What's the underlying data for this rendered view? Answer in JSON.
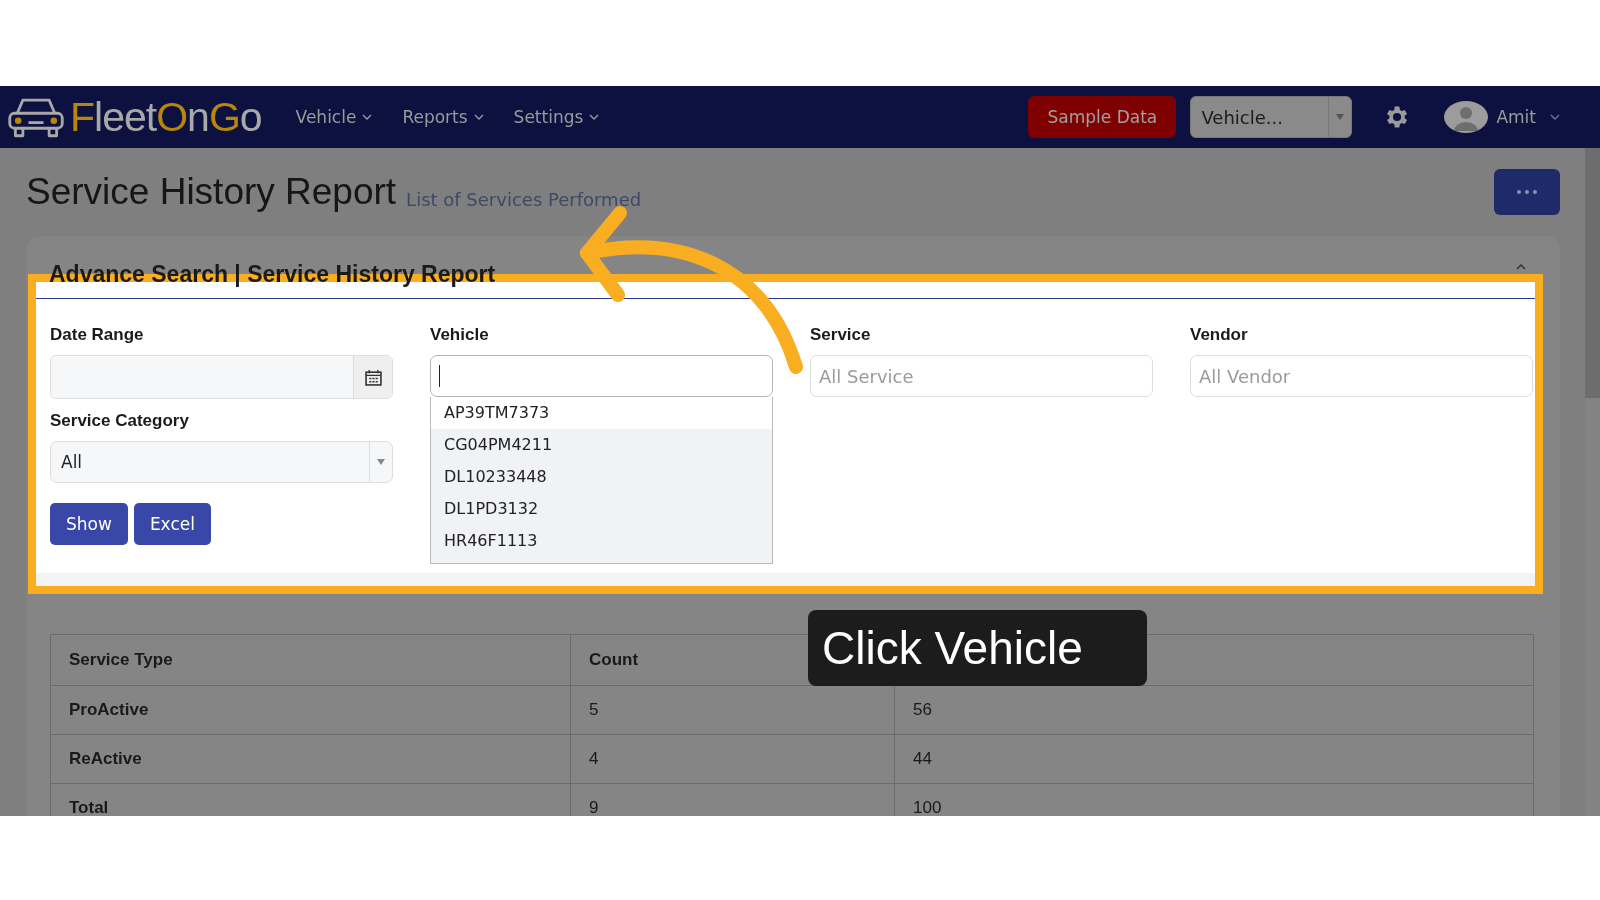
{
  "logo": {
    "parts": [
      {
        "text": "F",
        "accent": true
      },
      {
        "text": "leet",
        "accent": false
      },
      {
        "text": "O",
        "accent": true
      },
      {
        "text": "n",
        "accent": false
      },
      {
        "text": "G",
        "accent": true
      },
      {
        "text": "o",
        "accent": false
      }
    ]
  },
  "nav": {
    "menus": [
      "Vehicle",
      "Reports",
      "Settings"
    ],
    "sample_data_button": "Sample Data",
    "vehicle_select": "Vehicle...",
    "user": "Amit"
  },
  "page": {
    "title": "Service History Report",
    "subtitle": "List of Services Performed"
  },
  "search": {
    "title": "Advance Search | Service History Report",
    "expanded": true,
    "fields": [
      {
        "kind": "date",
        "label": "Date Range"
      },
      {
        "kind": "search",
        "label": "Vehicle",
        "focused": true,
        "options": [
          {
            "text": "AP39TM7373",
            "selected": true
          },
          {
            "text": "CG04PM4211",
            "selected": false
          },
          {
            "text": "DL10233448",
            "selected": false
          },
          {
            "text": "DL1PD3132",
            "selected": false
          },
          {
            "text": "HR46F1113",
            "selected": false
          }
        ]
      },
      {
        "kind": "text",
        "label": "Service",
        "placeholder": "All Service"
      },
      {
        "kind": "text",
        "label": "Vendor",
        "placeholder": "All Vendor"
      },
      {
        "kind": "select",
        "label": "Service Category",
        "value": "All"
      }
    ],
    "buttons": [
      "Show",
      "Excel"
    ]
  },
  "table": {
    "columns": [
      "Service Type",
      "Count"
    ],
    "rows": [
      [
        "ProActive",
        "5",
        "56"
      ],
      [
        "ReActive",
        "4",
        "44"
      ],
      [
        "Total",
        "9",
        "100"
      ]
    ]
  },
  "tooltip": "Click Vehicle"
}
